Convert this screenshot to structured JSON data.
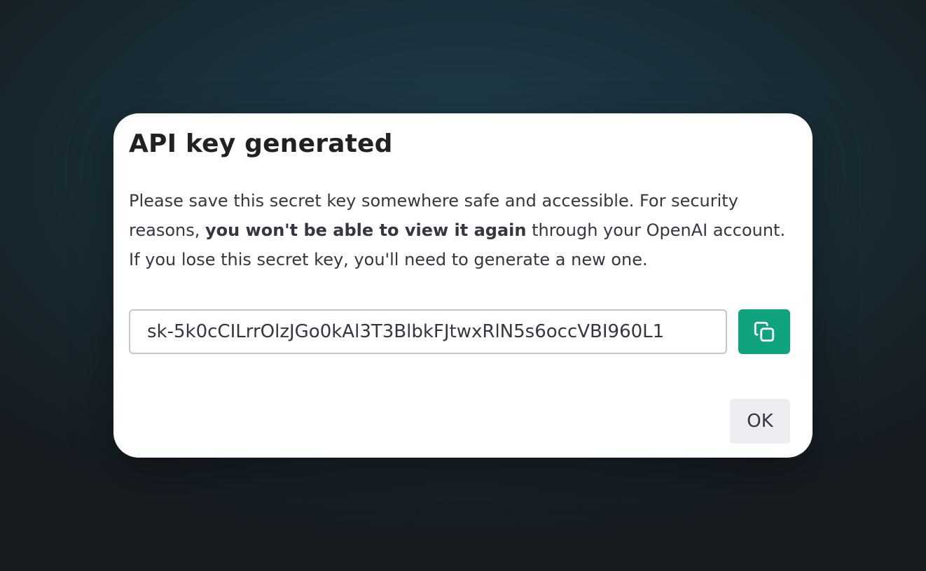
{
  "dialog": {
    "title": "API key generated",
    "description": {
      "part1": "Please save this secret key somewhere safe and accessible. For security reasons, ",
      "bold": "you won't be able to view it again",
      "part2": " through your OpenAI account. If you lose this secret key, you'll need to generate a new one."
    },
    "api_key_value": "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",
    "copy_icon": "copy-icon",
    "ok_label": "OK"
  },
  "colors": {
    "accent": "#10a37f",
    "ok_button_bg": "#ececf1",
    "backdrop": "#1f3d4a"
  }
}
